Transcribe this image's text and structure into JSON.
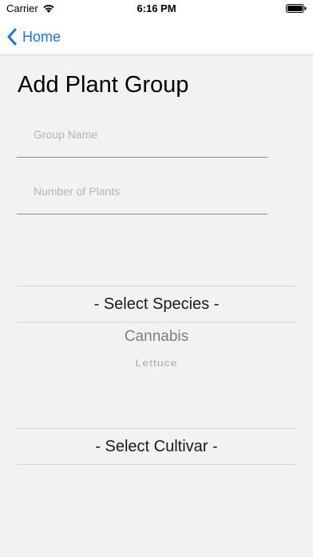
{
  "status_bar": {
    "carrier": "Carrier",
    "time": "6:16 PM"
  },
  "nav": {
    "back_label": "Home",
    "accent_color": "#1a73e8"
  },
  "page": {
    "title": "Add Plant Group"
  },
  "form": {
    "group_name": {
      "placeholder": "Group Name",
      "value": ""
    },
    "plant_count": {
      "placeholder": "Number of Plants",
      "value": ""
    }
  },
  "species_picker": {
    "selected_label": "- Select Species -",
    "options": [
      "Cannabis",
      "Lettuce"
    ]
  },
  "cultivar_picker": {
    "selected_label": "- Select Cultivar -"
  }
}
